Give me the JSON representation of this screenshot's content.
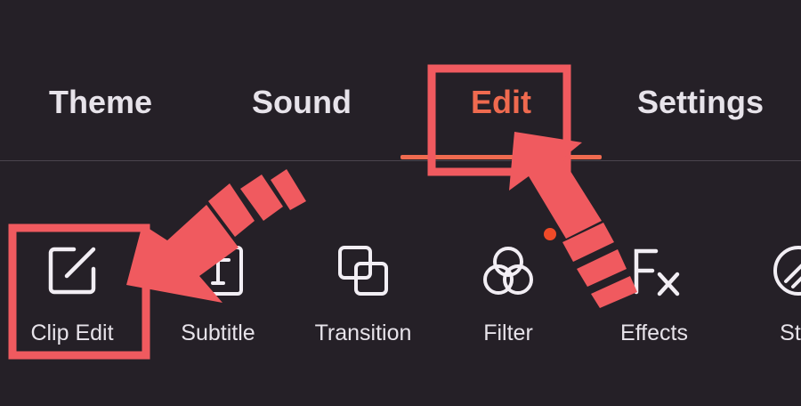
{
  "tabs": [
    {
      "label": "Theme",
      "active": false
    },
    {
      "label": "Sound",
      "active": false
    },
    {
      "label": "Edit",
      "active": true
    },
    {
      "label": "Settings",
      "active": false
    }
  ],
  "tools": [
    {
      "label": "Clip Edit",
      "icon": "clip-edit-icon"
    },
    {
      "label": "Subtitle",
      "icon": "subtitle-icon"
    },
    {
      "label": "Transition",
      "icon": "transition-icon"
    },
    {
      "label": "Filter",
      "icon": "filter-icon"
    },
    {
      "label": "Effects",
      "icon": "effects-icon"
    },
    {
      "label": "Stic",
      "icon": "sticker-icon"
    }
  ],
  "colors": {
    "background": "#252027",
    "accent": "#ef6a4f",
    "annotation": "#f05a5f",
    "text": "#e7e3ea"
  }
}
